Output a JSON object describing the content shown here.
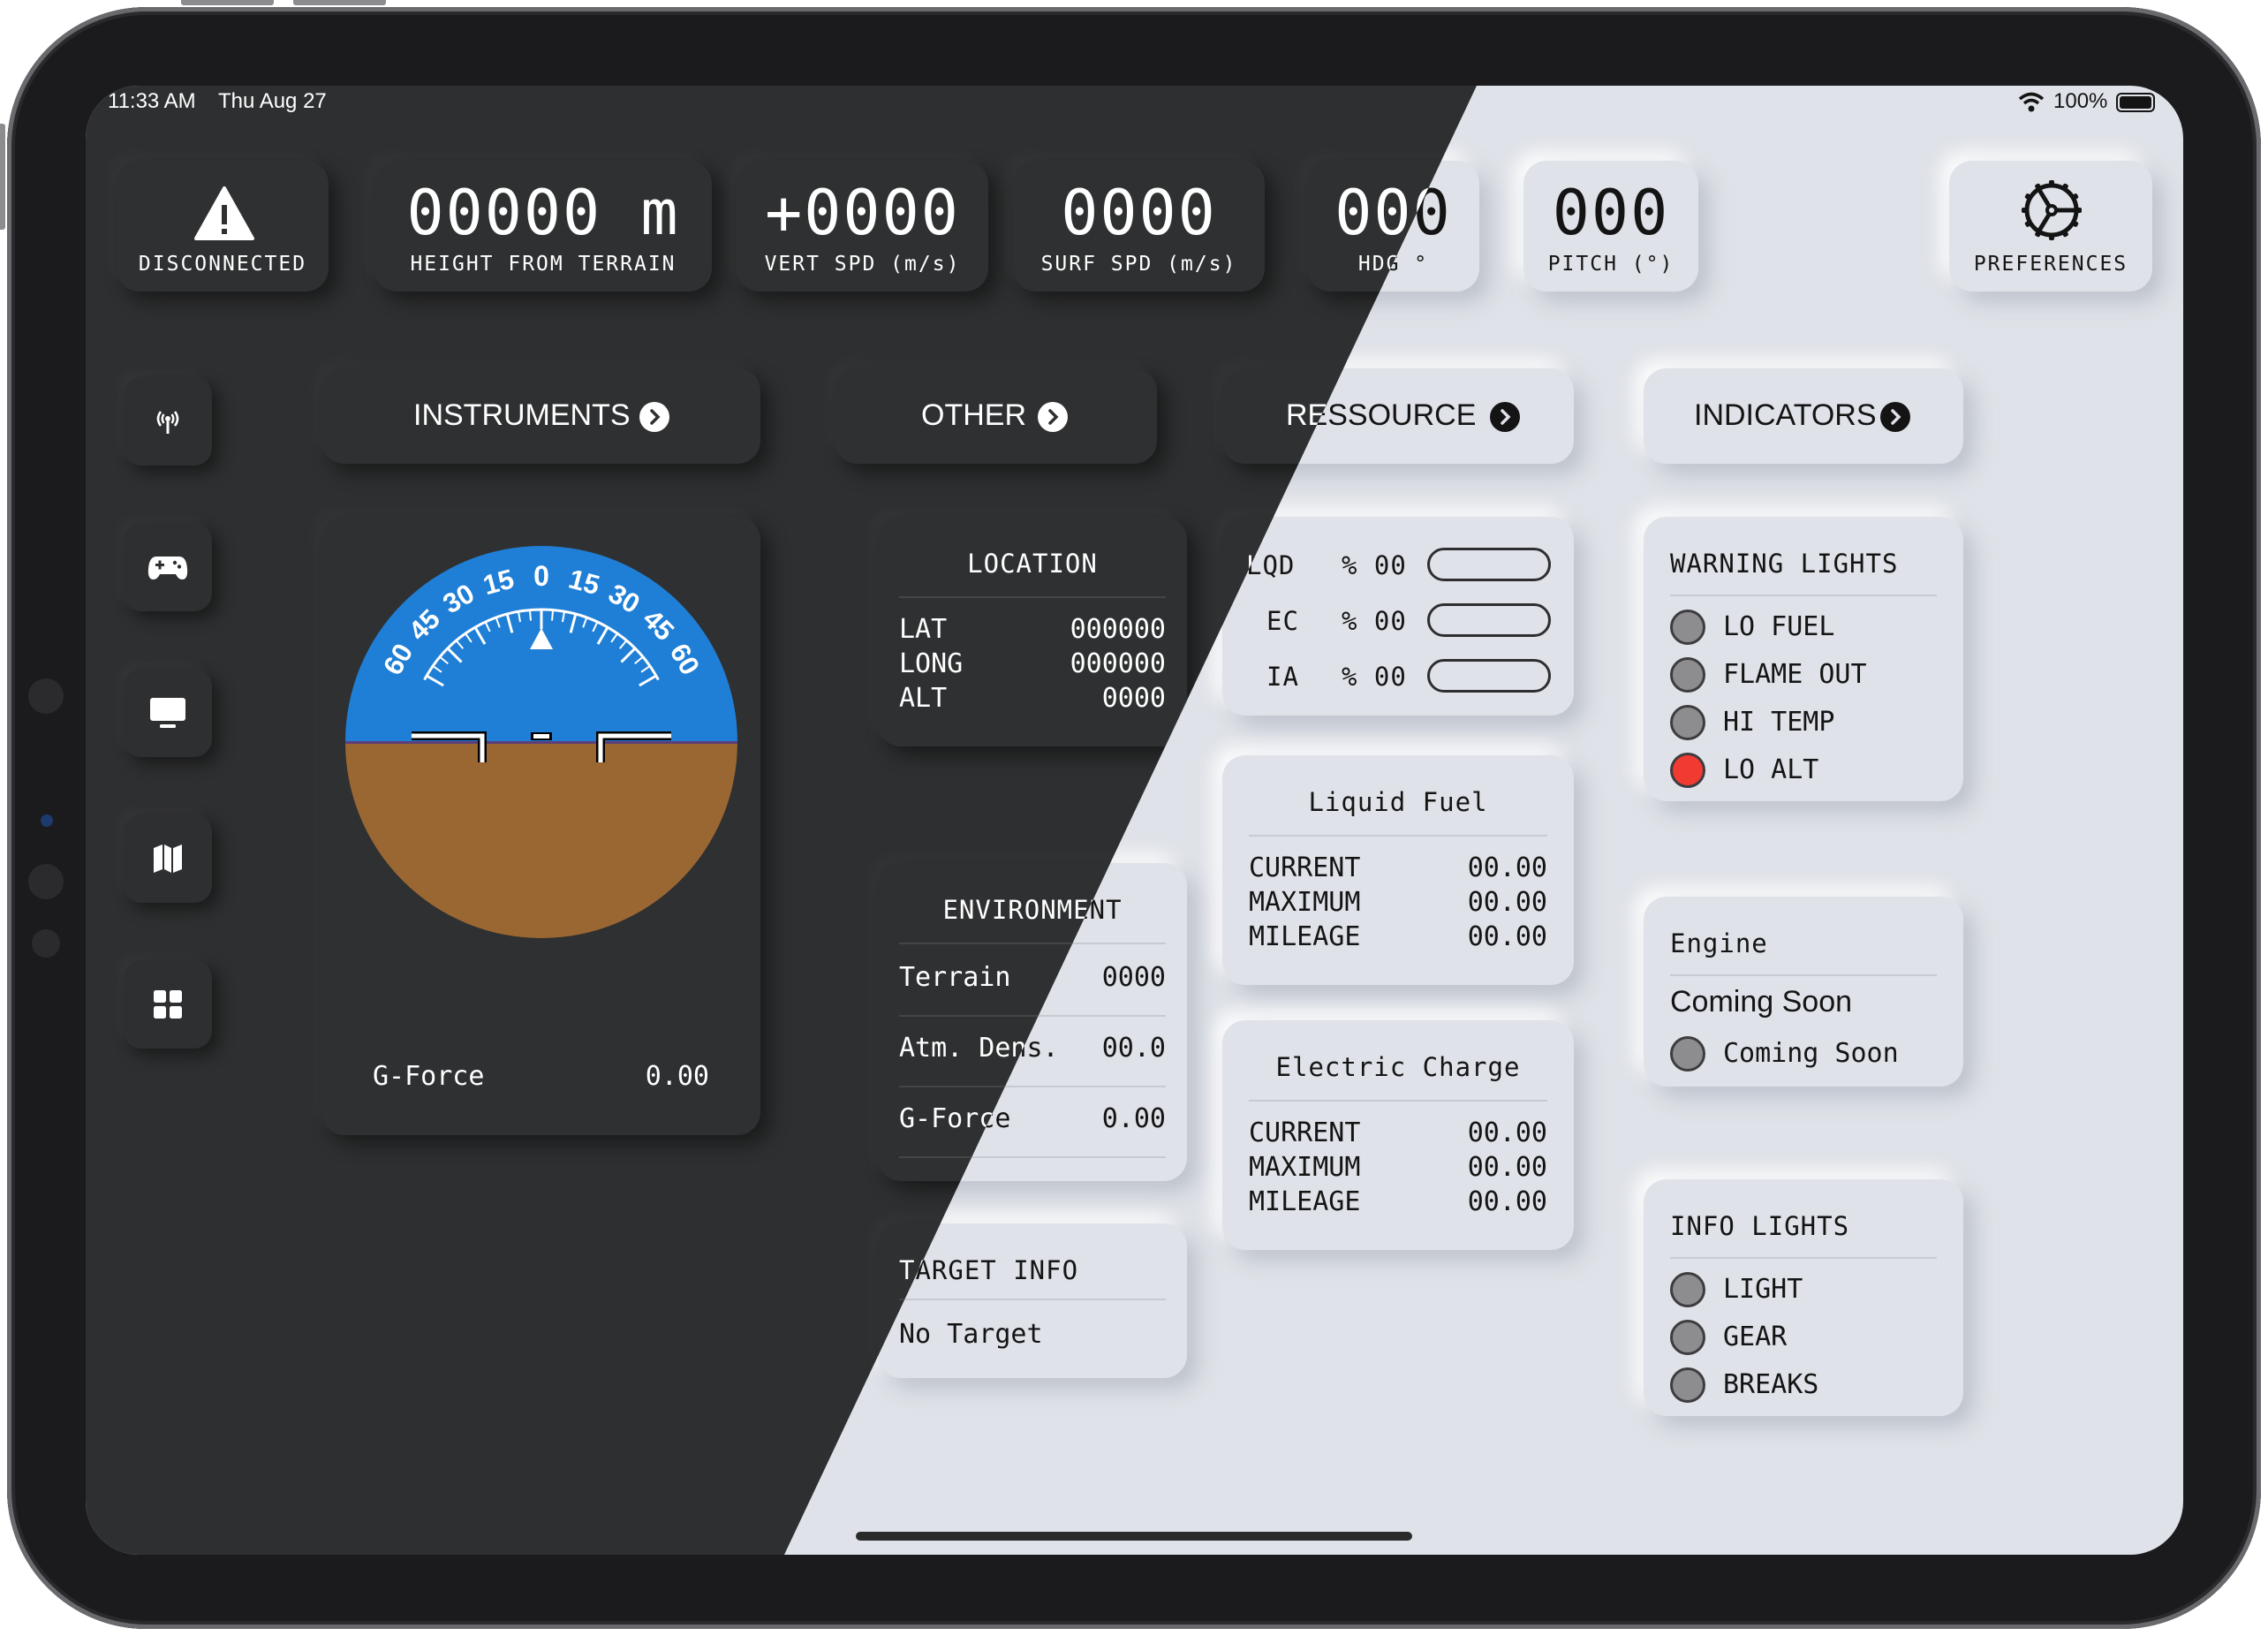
{
  "status_bar": {
    "time": "11:33 AM",
    "date": "Thu Aug 27",
    "battery": "100%"
  },
  "header": {
    "connection": {
      "label": "DISCONNECTED",
      "icon": "warning-icon"
    },
    "height": {
      "value": "00000 m",
      "label": "HEIGHT FROM TERRAIN"
    },
    "vert_speed": {
      "value": "+0000",
      "label": "VERT SPD (m/s)"
    },
    "surf_speed": {
      "value": "0000",
      "label": "SURF SPD (m/s)"
    },
    "heading": {
      "value": "000",
      "label": "HDG °"
    },
    "pitch": {
      "value": "000",
      "label": "PITCH (°)"
    },
    "preferences": {
      "label": "PREFERENCES",
      "icon": "steering-wheel-icon"
    }
  },
  "sidebar": {
    "items": [
      {
        "name": "antenna",
        "icon": "antenna-icon"
      },
      {
        "name": "controller",
        "icon": "gamepad-icon"
      },
      {
        "name": "display",
        "icon": "monitor-icon"
      },
      {
        "name": "map",
        "icon": "map-icon"
      },
      {
        "name": "grid",
        "icon": "grid-icon"
      }
    ]
  },
  "tabs": {
    "instruments": "INSTRUMENTS",
    "other": "OTHER",
    "resource": "RESSOURCE",
    "indicators": "INDICATORS"
  },
  "attitude": {
    "scale_left": [
      "60",
      "45",
      "30",
      "15"
    ],
    "scale_center": "0",
    "scale_right": [
      "15",
      "30",
      "45",
      "60"
    ],
    "gforce_label": "G-Force",
    "gforce_value": "0.00",
    "colors": {
      "sky": "#1f7fd6",
      "ground": "#9a6732"
    }
  },
  "location": {
    "title": "LOCATION",
    "rows": [
      {
        "label": "LAT",
        "value": "000000"
      },
      {
        "label": "LONG",
        "value": "000000"
      },
      {
        "label": "ALT",
        "value": "0000"
      }
    ]
  },
  "environment": {
    "title": "ENVIRONMENT",
    "rows": [
      {
        "label": "Terrain",
        "value": "0000"
      },
      {
        "label": "Atm. Dens.",
        "value": "00.0"
      },
      {
        "label": "G-Force",
        "value": "0.00"
      }
    ]
  },
  "target": {
    "title": "TARGET INFO",
    "value": "No Target"
  },
  "resources": {
    "rows": [
      {
        "label": "LQD",
        "value": "% 00",
        "level": 0
      },
      {
        "label": "EC",
        "value": "% 00",
        "level": 0
      },
      {
        "label": "IA",
        "value": "% 00",
        "level": 0
      }
    ]
  },
  "liquid_fuel": {
    "title": "Liquid Fuel",
    "rows": [
      {
        "label": "CURRENT",
        "value": "00.00"
      },
      {
        "label": "MAXIMUM",
        "value": "00.00"
      },
      {
        "label": "MILEAGE",
        "value": "00.00"
      }
    ]
  },
  "electric_charge": {
    "title": "Electric Charge",
    "rows": [
      {
        "label": "CURRENT",
        "value": "00.00"
      },
      {
        "label": "MAXIMUM",
        "value": "00.00"
      },
      {
        "label": "MILEAGE",
        "value": "00.00"
      }
    ]
  },
  "warning_lights": {
    "title": "WARNING LIGHTS",
    "items": [
      {
        "label": "LO FUEL",
        "state": "off"
      },
      {
        "label": "FLAME OUT",
        "state": "off"
      },
      {
        "label": "HI TEMP",
        "state": "off"
      },
      {
        "label": "LO ALT",
        "state": "on"
      }
    ],
    "colors": {
      "off": "#8d8d8f",
      "on": "#f13a32"
    }
  },
  "engine": {
    "title": "Engine",
    "subtitle": "Coming Soon",
    "items": [
      {
        "label": "Coming Soon",
        "state": "off"
      }
    ]
  },
  "info_lights": {
    "title": "INFO LIGHTS",
    "items": [
      {
        "label": "LIGHT",
        "state": "off"
      },
      {
        "label": "GEAR",
        "state": "off"
      },
      {
        "label": "BREAKS",
        "state": "off"
      }
    ]
  },
  "theme_colors": {
    "dark_bg": "#2e2f30",
    "light_bg": "#dfe2e8"
  }
}
